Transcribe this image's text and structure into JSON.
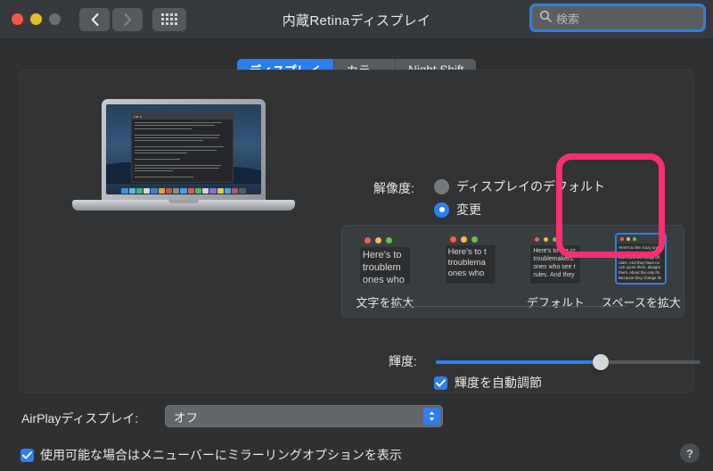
{
  "window": {
    "title": "内蔵Retinaディスプレイ",
    "controls": {
      "close": "close-button",
      "minimize": "minimize-button",
      "zoom": "zoom-button"
    },
    "nav": {
      "back": "back-button",
      "forward": "forward-button",
      "show_all": "show-all-button"
    }
  },
  "search": {
    "placeholder": "検索",
    "value": "",
    "icon": "search-icon",
    "focused": true
  },
  "tabs": [
    {
      "label": "ディスプレイ",
      "active": true
    },
    {
      "label": "カラー",
      "active": false
    },
    {
      "label": "Night Shift",
      "active": false
    }
  ],
  "resolution": {
    "label": "解像度:",
    "options": [
      {
        "label": "ディスプレイのデフォルト",
        "selected": false
      },
      {
        "label": "変更",
        "selected": true
      }
    ]
  },
  "scaling": {
    "left_label": "文字を拡大",
    "default_label": "デフォルト",
    "right_label": "スペースを拡大",
    "selected_index": 3,
    "preview_text": "Here's to the crazy ones. The misfits. The rebels. The troublemakers. The round pegs in the square holes. The ones who see things differently. They're not fond of rules. And they have no respect for the status quo. You can quote them, disagree with them, glorify or vilify them. About the only thing you can't do is ignore them. Because they change things.",
    "thumbnails": [
      {
        "name": "scaling-option-largest-text",
        "label": "文字を拡大",
        "lines": [
          "Here's to",
          "troublem",
          "ones who"
        ]
      },
      {
        "name": "scaling-option-larger-text",
        "label": "",
        "lines": [
          "Here's to t",
          "troublema",
          "ones who"
        ]
      },
      {
        "name": "scaling-option-default",
        "label": "デフォルト",
        "lines": [
          "Here's to the cr",
          "troublemakers.",
          "ones who see t",
          "rules. And they"
        ]
      },
      {
        "name": "scaling-option-more-space",
        "label": "スペースを拡大",
        "lines": [
          "Here's to the crazy ones",
          "troublemakers. The rou",
          "ones who see things dif",
          "rules. And they have no",
          "can quote them, disagre",
          "them. About the only thi",
          "Because they change thi"
        ]
      }
    ]
  },
  "annotation": {
    "shape": "rounded-rectangle",
    "color": "#fa2e70",
    "target": "scaling-option-more-space"
  },
  "brightness": {
    "label": "輝度:",
    "value_percent": 63,
    "auto_adjust": {
      "label": "輝度を自動調節",
      "checked": true
    }
  },
  "airplay": {
    "label": "AirPlayディスプレイ:",
    "value": "オフ",
    "options": [
      "オフ"
    ]
  },
  "mirror_option": {
    "label": "使用可能な場合はメニューバーにミラーリングオプションを表示",
    "checked": true
  },
  "help": {
    "label": "?"
  },
  "colors": {
    "accent": "#2b7ff0",
    "annotation": "#fa2e70",
    "window_bg": "#2e3032",
    "titlebar_bg": "#373a3c",
    "panel_bg": "#313335"
  }
}
